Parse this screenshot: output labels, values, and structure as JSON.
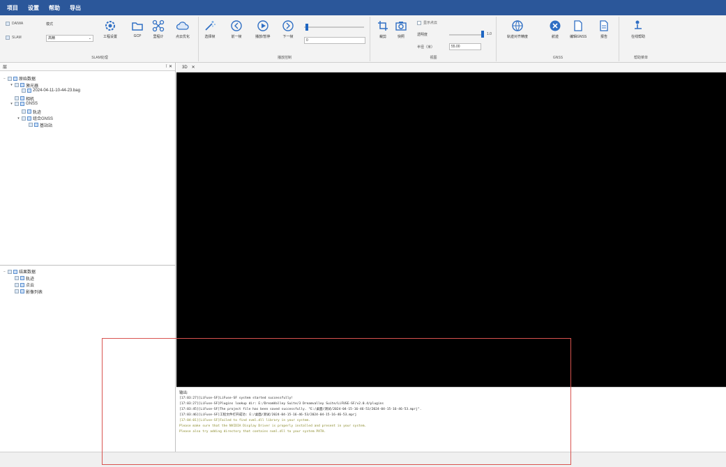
{
  "menu": [
    "项目",
    "设置",
    "帮助",
    "导出"
  ],
  "colors": {
    "accent": "#2b579a",
    "highlight": "#d9534f"
  },
  "ribbon": {
    "slam_group": {
      "label": "SLAM处理",
      "option_daiwa": "DAIWA",
      "option_slam": "SLAM",
      "mode_label": "模式",
      "select_value": "高精",
      "buttons": [
        "工程设置",
        "GCP",
        "里程计",
        "点云优化"
      ],
      "icons": [
        "settings-icon",
        "folder-icon",
        "network-icon",
        "cloud-icon"
      ]
    },
    "playback_group": {
      "label": "播放控制",
      "buttons": [
        "选择帧",
        "前一帧",
        "播放/暂停",
        "下一帧"
      ],
      "frame_value": "0"
    },
    "view_group": {
      "label": "视图",
      "buttons": [
        "裁剪",
        "快照"
      ],
      "show_checkbox": "显示点云",
      "transparency_label": "透明度",
      "transparency_value": "1.0",
      "pointsize_label": "半径（米）",
      "pointsize_value": "55.00"
    },
    "gnss_group": {
      "label": "GNSS",
      "buttons": [
        "轨迹对齐精度",
        "航迹",
        "编辑GNSS",
        "报告"
      ]
    },
    "help_group": {
      "label": "帮助菜单",
      "buttons": [
        "在线帮助"
      ]
    }
  },
  "layers_panel": {
    "title": "层",
    "tree": [
      {
        "level": 0,
        "text": "原始数据",
        "toggle": "−"
      },
      {
        "level": 1,
        "text": "激光器",
        "toggle": "▾"
      },
      {
        "level": 2,
        "text": "2024-04-11-10-44-23.bag",
        "toggle": ""
      },
      {
        "level": 1,
        "text": "相机",
        "toggle": ""
      },
      {
        "level": 1,
        "text": "GNSS",
        "toggle": "▾"
      },
      {
        "level": 2,
        "text": "轨迹",
        "toggle": ""
      },
      {
        "level": 2,
        "text": "组合GNSS",
        "toggle": "▾"
      },
      {
        "level": 3,
        "text": "基站站",
        "toggle": ""
      }
    ]
  },
  "results_panel": {
    "tree": [
      {
        "level": 0,
        "text": "结果数据",
        "toggle": "−"
      },
      {
        "level": 1,
        "text": "轨迹",
        "toggle": ""
      },
      {
        "level": 1,
        "text": "点云",
        "toggle": ""
      },
      {
        "level": 1,
        "text": "影像列表",
        "toggle": ""
      }
    ]
  },
  "view": {
    "tab": "3D"
  },
  "output": {
    "title": "输出:",
    "lines": [
      {
        "text": "[17:03:27][LiFuse-SF]LiFuse-SF system started successfully!",
        "color": "#2a2a2a"
      },
      {
        "text": "[17:03:27][LiFuse-SF]Plugins lookup dir: E:/DreamValley Suite/3 Dreamvalley Suite/LiFUSE-SF/v2.0.4/plugins",
        "color": "#2a2a2a"
      },
      {
        "text": "[17:03:45][LiFuse-SF]The project file has been saved successfully. \"E:/桌面/测试/2024-04-15-16-46-53/2024-04-15-16-46-53.mprj\".",
        "color": "#2a2a2a"
      },
      {
        "text": "[17:03:46][LiFuse-SF]工程文件打开成功: E:/桌面/测试/2024-04-15-16-46-53/2024-04-15-16-46-53.mprj",
        "color": "#2a2a2a"
      },
      {
        "text": "[17:04:01][LiFuse-SF]Failed to find nvml.dll library in your system.",
        "color": "#8a8a2a"
      },
      {
        "text": "Please make sure that the NVIDIA Display Driver is properly installed and present in your system.",
        "color": "#8a8a2a"
      },
      {
        "text": "Please also try adding directory that contains nvml.dll to your system PATH.",
        "color": "#8a8a2a"
      }
    ]
  }
}
